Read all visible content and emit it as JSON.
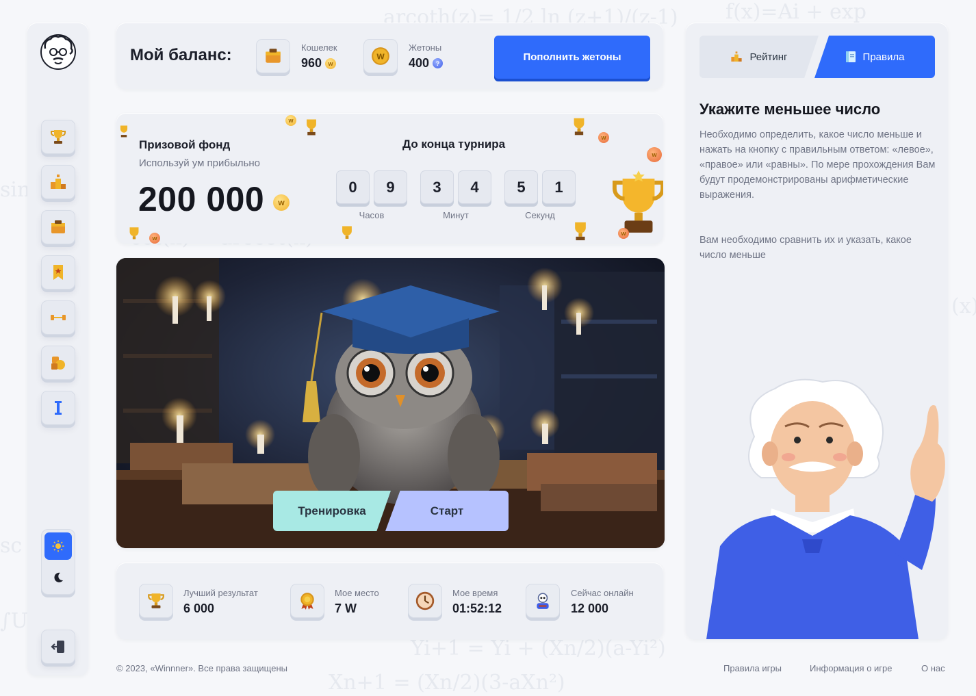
{
  "balance": {
    "title": "Мой баланс:",
    "wallet_label": "Кошелек",
    "wallet_value": "960",
    "tokens_label": "Жетоны",
    "tokens_value": "400",
    "topup_label": "Пополнить жетоны"
  },
  "prize": {
    "title": "Призовой фонд",
    "subtitle": "Используй ум прибыльно",
    "amount": "200 000",
    "timer_title": "До конца турнира",
    "digits": [
      "0",
      "9",
      "3",
      "4",
      "5",
      "1"
    ],
    "units": [
      "Часов",
      "Минут",
      "Секунд"
    ]
  },
  "hero": {
    "train_label": "Тренировка",
    "start_label": "Старт"
  },
  "stats": [
    {
      "label": "Лучший результат",
      "value": "6 000",
      "icon": "trophy-icon"
    },
    {
      "label": "Мое место",
      "value": "7 W",
      "icon": "medal-icon"
    },
    {
      "label": "Мое время",
      "value": "01:52:12",
      "icon": "clock-icon"
    },
    {
      "label": "Сейчас онлайн",
      "value": "12 000",
      "icon": "online-users-icon"
    }
  ],
  "sidebar": {
    "items": [
      "trophy-icon",
      "podium-icon",
      "wallet-icon",
      "bookmark-icon",
      "dumbbell-icon",
      "coins-icon",
      "info-icon"
    ],
    "theme": [
      "sun-icon",
      "moon-icon"
    ],
    "logout": "logout-icon"
  },
  "rules": {
    "tab_rating": "Рейтинг",
    "tab_rules": "Правила",
    "title": "Укажите меньшее число",
    "paragraph1": "Необходимо определить, какое число меньше и нажать на кнопку с правильным ответом: «левое», «правое» или «равны». По мере прохождения Вам будут продемонстрированы арифметические выражения.",
    "paragraph2": "Вам необходимо сравнить их и указать, какое число меньше"
  },
  "footer": {
    "copyright": "© 2023, «Winnner». Все права защищены",
    "links": [
      "Правила игры",
      "Информация о игре",
      "О нас"
    ]
  },
  "colors": {
    "accent": "#2f6bfb",
    "train_button": "#a8e9e4",
    "start_button": "#b6c2ff",
    "panel": "#eef0f5"
  }
}
